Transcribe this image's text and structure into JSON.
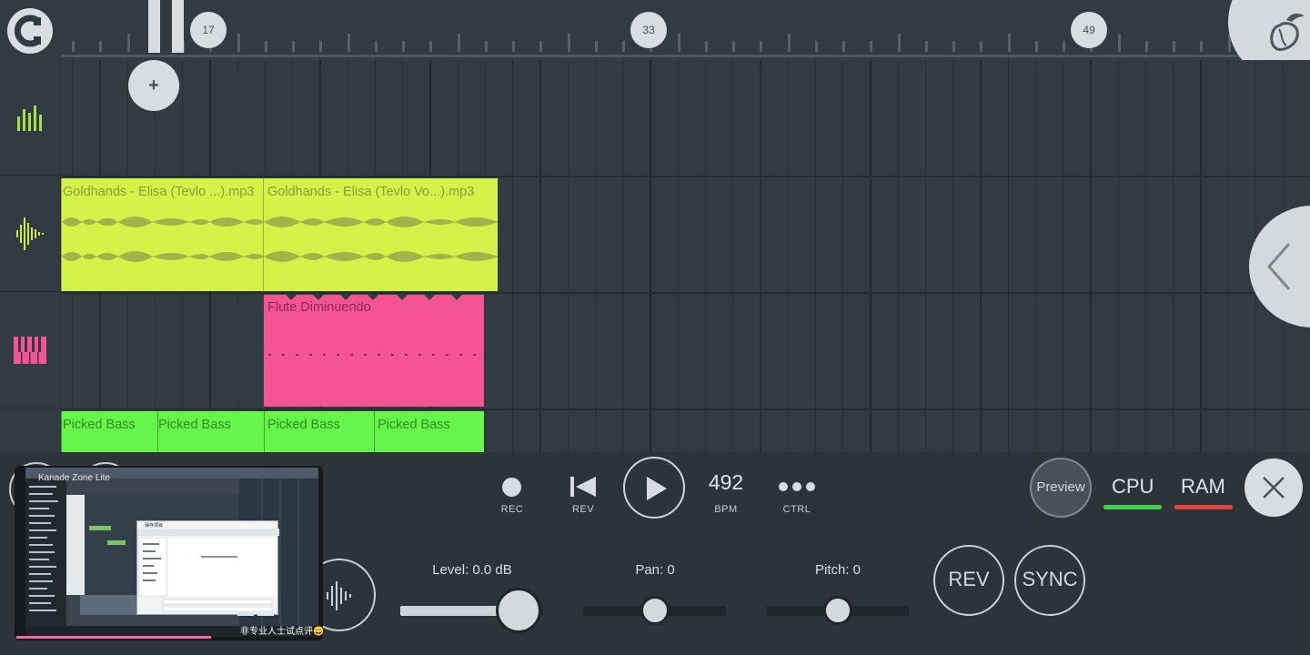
{
  "timeline": {
    "bar_markers": [
      "17",
      "33",
      "49"
    ]
  },
  "playlist": {
    "add_button": "+",
    "clips": [
      {
        "title": "Goldhands - Elisa (Tevlo ...).mp3",
        "kind": "audio"
      },
      {
        "title": "Goldhands - Elisa (Tevlo Vo...).mp3",
        "kind": "audio"
      },
      {
        "title": "Flute Diminuendo",
        "kind": "pattern"
      },
      {
        "title": "Picked Bass",
        "kind": "bass"
      },
      {
        "title": "Picked Bass",
        "kind": "bass"
      },
      {
        "title": "Picked Bass",
        "kind": "bass"
      },
      {
        "title": "Picked Bass",
        "kind": "bass"
      }
    ]
  },
  "transport": {
    "rec_label": "REC",
    "rev_label": "REV",
    "bpm_value": "492",
    "bpm_label": "BPM",
    "ctrl_label": "CTRL"
  },
  "status": {
    "preview_label": "Preview",
    "cpu_label": "CPU",
    "ram_label": "RAM"
  },
  "sample_controls": {
    "level_label": "Level: 0.0 dB",
    "level_fraction": 0.83,
    "pan_label": "Pan: 0",
    "pan_fraction": 0.5,
    "pitch_label": "Pitch: 0",
    "pitch_fraction": 0.5,
    "rev_button": "REV",
    "sync_button": "SYNC"
  },
  "video_overlay": {
    "title": "Kanade Zone  Lite",
    "subtitle": "非专业人士试点评😀",
    "dialog_text": "保存项目",
    "progress_fraction": 0.64
  },
  "colors": {
    "audio_clip": "#d4f247",
    "pattern_clip": "#f45492",
    "bass_clip": "#67f44b",
    "cpu_meter": "#3fd14a",
    "ram_meter": "#e2443c",
    "background": "#2c343a"
  },
  "icons": {
    "logo": "magnet-icon",
    "corner": "fl-fruit-icon",
    "mixer": "mixer-bars-icon",
    "audio": "waveform-icon",
    "piano": "piano-icon",
    "collapse": "chevron-left-icon",
    "close": "close-icon",
    "play": "play-icon"
  }
}
